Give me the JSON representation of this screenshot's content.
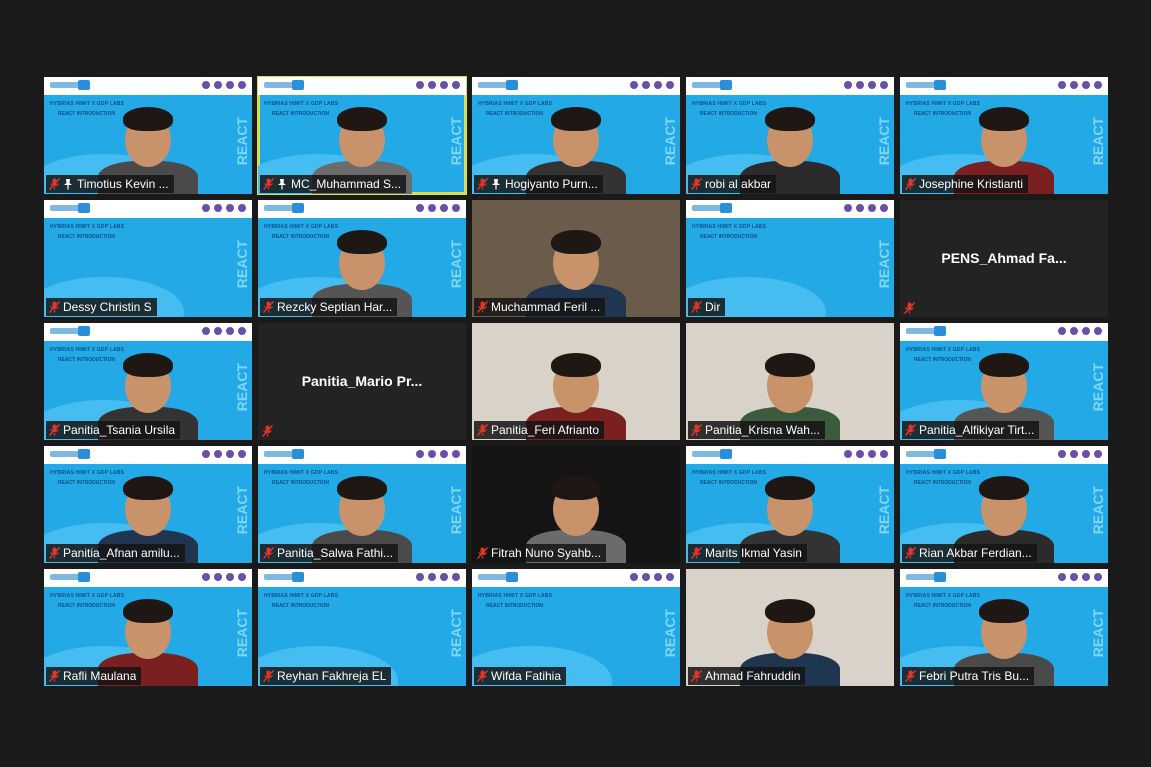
{
  "slide": {
    "title": "HYBRIAS HIMIT X GDP LABS",
    "subtitle": "REACT INTRODUCTION",
    "vertical": "REACT"
  },
  "participants": [
    {
      "name": "Timotius Kevin ...",
      "video": "slide",
      "pinned": true
    },
    {
      "name": "MC_Muhammad S...",
      "video": "slide",
      "pinned": true,
      "speaking": true
    },
    {
      "name": "Hogiyanto Purn...",
      "video": "slide",
      "pinned": true
    },
    {
      "name": "robi al akbar",
      "video": "slide"
    },
    {
      "name": "Josephine Kristianti",
      "video": "slide"
    },
    {
      "name": "Dessy Christin S",
      "video": "slide"
    },
    {
      "name": "Rezcky Septian Har...",
      "video": "slide"
    },
    {
      "name": "Muchammad Feril ...",
      "video": "photo"
    },
    {
      "name": "Dir",
      "video": "slide"
    },
    {
      "name": "PENS_Ahmad  Fa...",
      "video": "off"
    },
    {
      "name": "Panitia_Tsania Ursila",
      "video": "slide"
    },
    {
      "name": "Panitia_Mario  Pr...",
      "video": "off"
    },
    {
      "name": "Panitia_Feri Afrianto",
      "video": "photo-light"
    },
    {
      "name": "Panitia_Krisna Wah...",
      "video": "photo-light"
    },
    {
      "name": "Panitia_Alfikiyar Tirt...",
      "video": "slide"
    },
    {
      "name": "Panitia_Afnan amilu...",
      "video": "slide"
    },
    {
      "name": "Panitia_Salwa Fathi...",
      "video": "slide"
    },
    {
      "name": "Fitrah Nuno Syahb...",
      "video": "photo-black"
    },
    {
      "name": "Marits Ikmal Yasin",
      "video": "slide"
    },
    {
      "name": "Rian Akbar Ferdian...",
      "video": "slide"
    },
    {
      "name": "Rafli Maulana",
      "video": "slide"
    },
    {
      "name": "Reyhan Fakhreja EL",
      "video": "slide"
    },
    {
      "name": "Wifda Fatihia",
      "video": "slide"
    },
    {
      "name": "Ahmad Fahruddin",
      "video": "photo-light"
    },
    {
      "name": "Febri Putra Tris Bu...",
      "video": "slide"
    }
  ],
  "colors": {
    "muted_mic": "#e0352b",
    "active_speaker": "#d4e157",
    "slide_blue": "#23a9e6"
  },
  "icons": {
    "muted": "microphone-muted-icon",
    "pin": "pin-icon"
  }
}
